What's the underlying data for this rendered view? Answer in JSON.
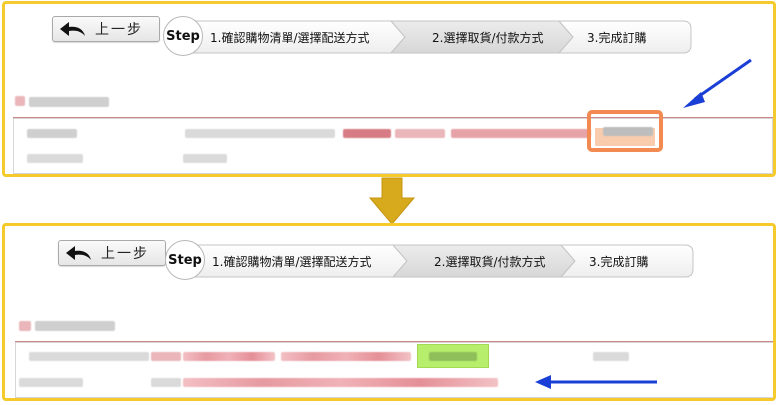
{
  "back_button": {
    "label": "上一步"
  },
  "stepbar": {
    "badge": "Step",
    "steps": [
      {
        "label": "1.確認購物清單/選擇配送方式"
      },
      {
        "label": "2.選擇取貨/付款方式"
      },
      {
        "label": "3.完成訂購"
      }
    ]
  },
  "colors": {
    "frame": "#f4ca2c",
    "annotation_arrow": "#1a3fd6",
    "highlight_orange": "#f28a52",
    "highlight_green": "#b7ee6b",
    "divider": "#b4555a"
  },
  "icons": {
    "back": "curved-arrow-left-icon",
    "transition": "down-arrow-icon",
    "pointer": "blue-arrow-icon"
  }
}
